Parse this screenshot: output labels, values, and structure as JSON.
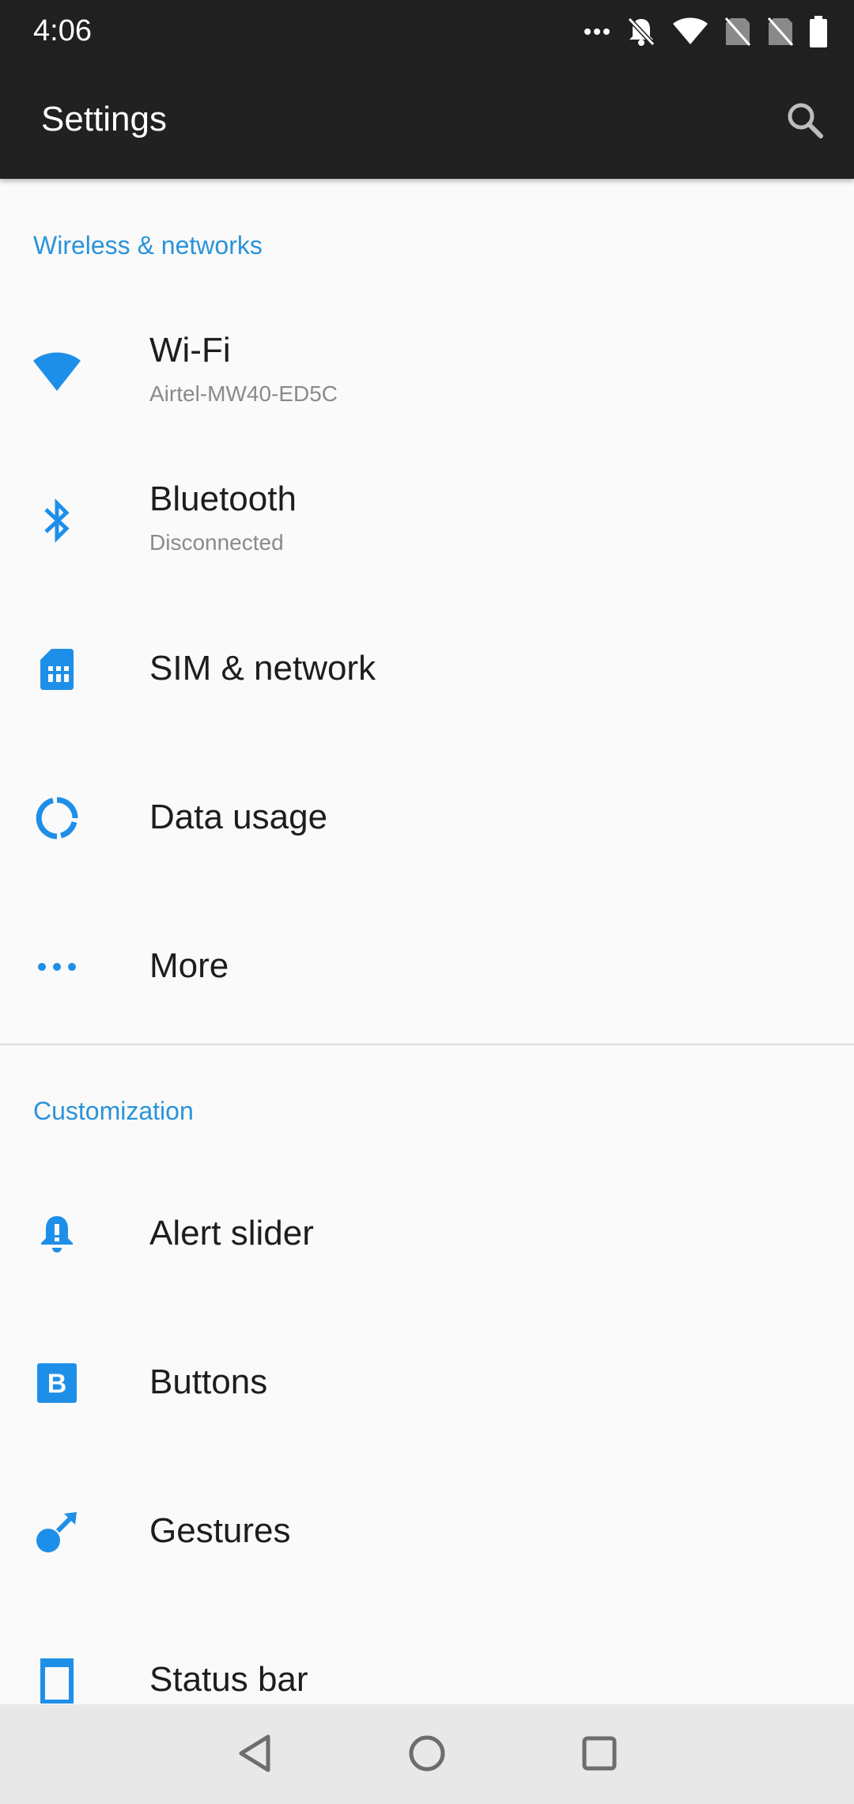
{
  "status_bar": {
    "time": "4:06",
    "icons": [
      "more-dots-icon",
      "notifications-off-icon",
      "wifi-icon",
      "no-sim-icon",
      "no-sim-icon",
      "battery-icon"
    ]
  },
  "app_bar": {
    "title": "Settings",
    "search_icon": "search-icon"
  },
  "colors": {
    "accent": "#2a93d9",
    "icon_blue": "#1e8fe9",
    "app_bar": "#212121",
    "background": "#fafafa"
  },
  "sections": [
    {
      "header": "Wireless & networks",
      "items": [
        {
          "title": "Wi-Fi",
          "subtitle": "Airtel-MW40-ED5C",
          "icon": "wifi-icon"
        },
        {
          "title": "Bluetooth",
          "subtitle": "Disconnected",
          "icon": "bluetooth-icon"
        },
        {
          "title": "SIM & network",
          "icon": "sim-card-icon"
        },
        {
          "title": "Data usage",
          "icon": "data-usage-icon"
        },
        {
          "title": "More",
          "icon": "more-dots-icon"
        }
      ]
    },
    {
      "header": "Customization",
      "items": [
        {
          "title": "Alert slider",
          "icon": "alert-bell-icon"
        },
        {
          "title": "Buttons",
          "icon": "buttons-b-icon"
        },
        {
          "title": "Gestures",
          "icon": "gestures-icon"
        },
        {
          "title": "Status bar",
          "icon": "status-bar-icon"
        }
      ]
    }
  ],
  "nav_bar": {
    "buttons": [
      "back-icon",
      "home-icon",
      "recents-icon"
    ]
  }
}
